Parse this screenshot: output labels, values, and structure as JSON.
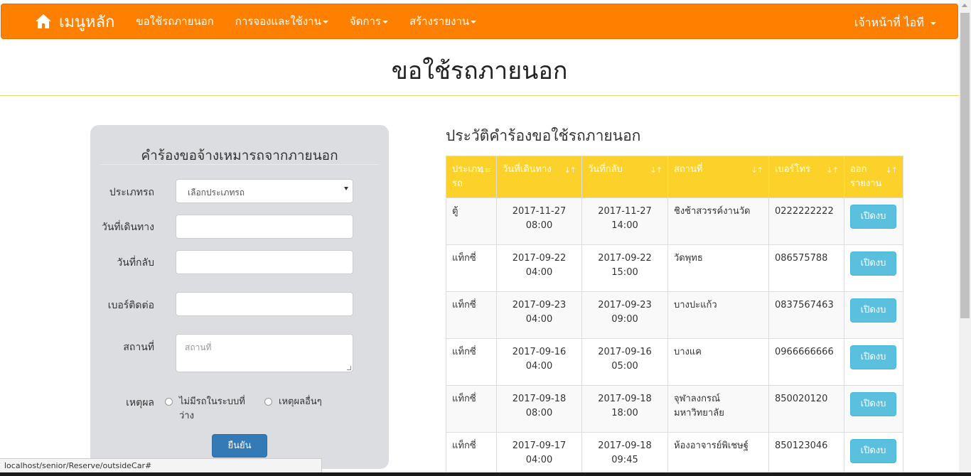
{
  "navbar": {
    "brand_label": "เมนูหลัก",
    "brand_icon": "home-icon",
    "items": [
      {
        "label": "ขอใช้รถภายนอก",
        "dropdown": false
      },
      {
        "label": "การจองและใช้งาน",
        "dropdown": true
      },
      {
        "label": "จัดการ",
        "dropdown": true
      },
      {
        "label": "สร้างรายงาน",
        "dropdown": true
      }
    ],
    "user_label": "เจ้าหน้าที่ ไอที",
    "color": "#ff8000"
  },
  "page": {
    "title": "ขอใช้รถภายนอก"
  },
  "form": {
    "title": "คำร้องขอจ้างเหมารถจากภายนอก",
    "vehicle_type_label": "ประเภทรถ",
    "vehicle_type_selected": "เลือกประเภทรถ",
    "depart_date_label": "วันที่เดินทาง",
    "return_date_label": "วันที่กลับ",
    "contact_label": "เบอร์ติดต่อ",
    "place_label": "สถานที่",
    "place_placeholder": "สถานที่",
    "reason_label": "เหตุผล",
    "reason_option1_line1": "ไม่มีรถในระบบที่",
    "reason_option1_line2": "ว่าง",
    "reason_option2": "เหตุผลอื่นๆ",
    "submit_label": "ยืนยัน",
    "submit_color": "#337ab7"
  },
  "history": {
    "title": "ประวัติคำร้องขอใช้รถภายนอก",
    "header_color": "#fcd12a",
    "columns": [
      {
        "line1": "ประเภท",
        "line2": "รถ"
      },
      {
        "line1": "วันที่เดินทาง",
        "line2": ""
      },
      {
        "line1": "วันที่กลับ",
        "line2": ""
      },
      {
        "line1": "สถานที่",
        "line2": ""
      },
      {
        "line1": "เบอร์โทร",
        "line2": ""
      },
      {
        "line1": "ออก",
        "line2": "รายงาน"
      }
    ],
    "open_label": "เปิดงบ",
    "rows": [
      {
        "type": "ตู้",
        "depart_date": "2017-11-27",
        "depart_time": "08:00",
        "return_date": "2017-11-27",
        "return_time": "14:00",
        "place": "ชิงช้าสวรรค์งานวัด",
        "phone": "0222222222"
      },
      {
        "type": "แท็กซี่",
        "depart_date": "2017-09-22",
        "depart_time": "04:00",
        "return_date": "2017-09-22",
        "return_time": "15:00",
        "place": "วัดพุทธ",
        "phone": "086575788"
      },
      {
        "type": "แท็กซี่",
        "depart_date": "2017-09-23",
        "depart_time": "04:00",
        "return_date": "2017-09-23",
        "return_time": "09:00",
        "place": "บางปะแก้ว",
        "phone": "0837567463"
      },
      {
        "type": "แท็กซี่",
        "depart_date": "2017-09-16",
        "depart_time": "04:00",
        "return_date": "2017-09-16",
        "return_time": "05:00",
        "place": "บางแค",
        "phone": "0966666666"
      },
      {
        "type": "แท็กซี่",
        "depart_date": "2017-09-18",
        "depart_time": "08:00",
        "return_date": "2017-09-18",
        "return_time": "18:00",
        "place": "จุฬาลงกรณ์มหาวิทยาลัย",
        "phone": "850020120"
      },
      {
        "type": "แท็กซี่",
        "depart_date": "2017-09-17",
        "depart_time": "04:00",
        "return_date": "2017-09-18",
        "return_time": "09:45",
        "place": "ห้องอาจารย์พิเชษฐ์",
        "phone": "850123046"
      }
    ]
  },
  "statusbar": {
    "url": "localhost/senior/Reserve/outsideCar#"
  }
}
